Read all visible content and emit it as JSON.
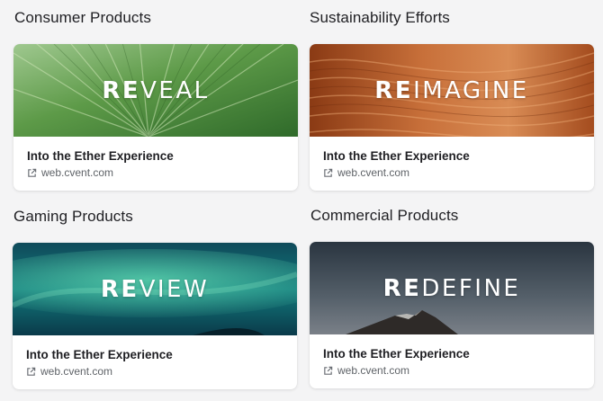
{
  "sections": [
    {
      "title": "Consumer Products",
      "banner": {
        "bold": "RE",
        "rest": "VEAL"
      },
      "card_title": "Into the Ether Experience",
      "link": "web.cvent.com",
      "icon": "external-link-icon"
    },
    {
      "title": "Sustainability Efforts",
      "banner": {
        "bold": "RE",
        "rest": "IMAGINE"
      },
      "card_title": "Into the Ether Experience",
      "link": "web.cvent.com",
      "icon": "external-link-icon"
    },
    {
      "title": "Gaming Products",
      "banner": {
        "bold": "RE",
        "rest": "VIEW"
      },
      "card_title": "Into the Ether Experience",
      "link": "web.cvent.com",
      "icon": "external-link-icon"
    },
    {
      "title": "Commercial Products",
      "banner": {
        "bold": "RE",
        "rest": "DEFINE"
      },
      "card_title": "Into the Ether Experience",
      "link": "web.cvent.com",
      "icon": "external-link-icon"
    }
  ],
  "colors": {
    "page_background": "#f4f4f5",
    "card_background": "#ffffff",
    "link_text": "#5f6368"
  }
}
